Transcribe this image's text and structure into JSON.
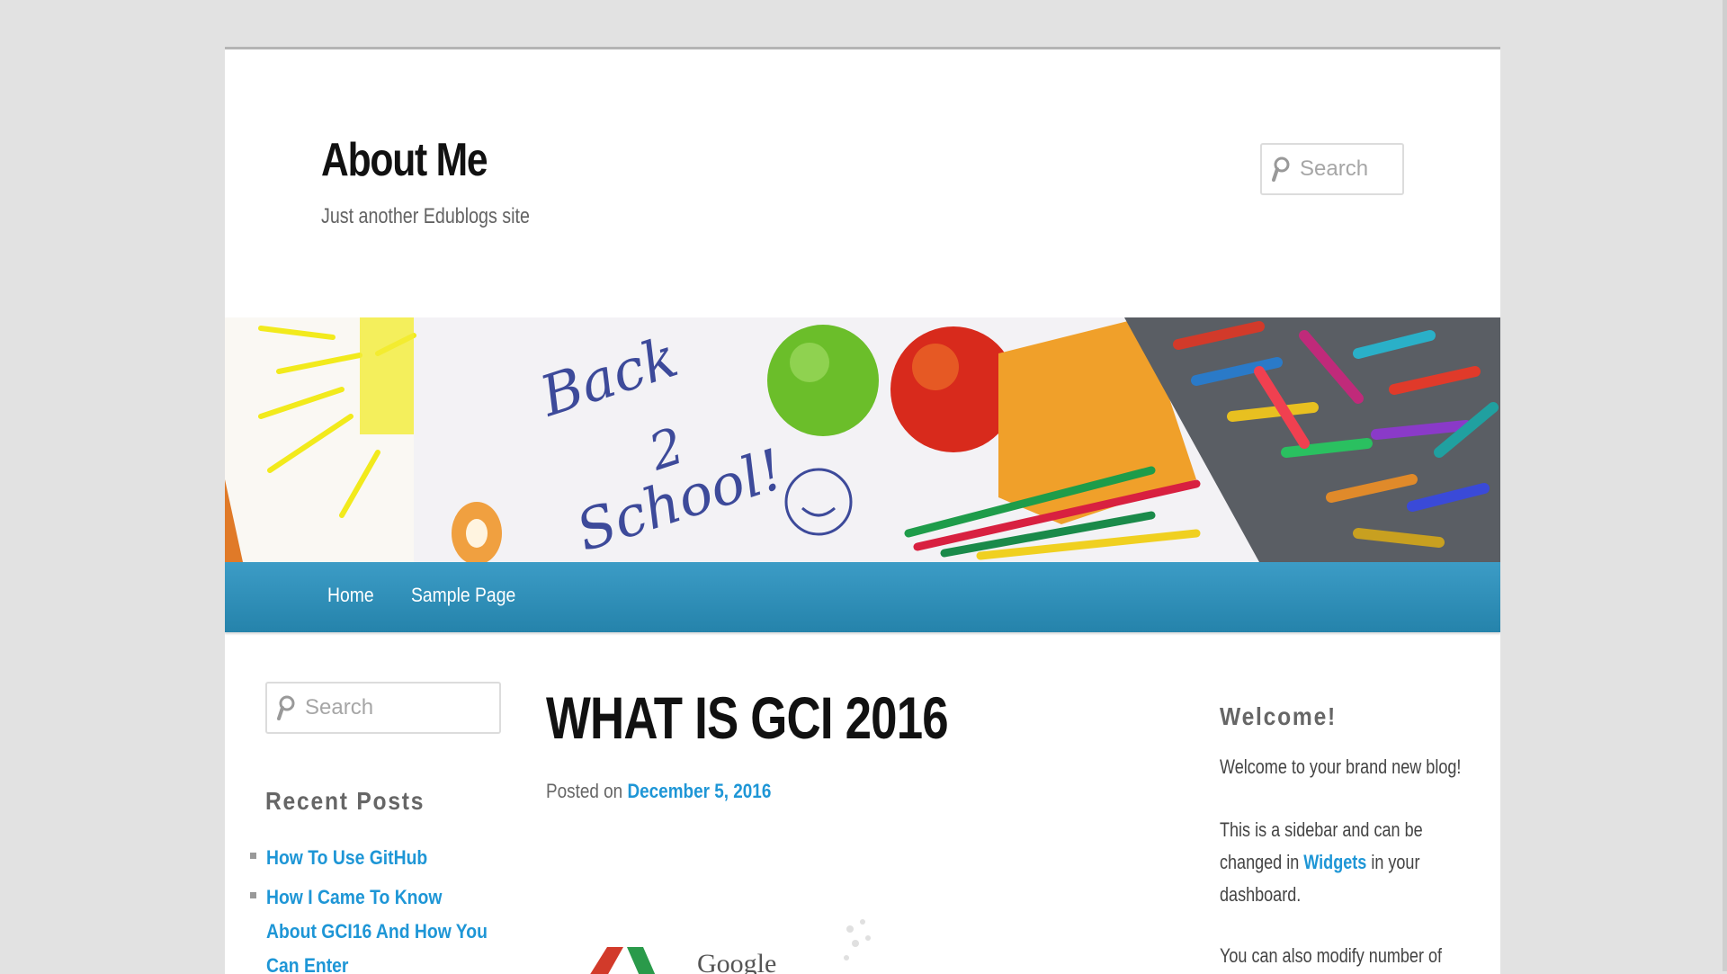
{
  "site": {
    "title": "About Me",
    "description": "Just another Edublogs site"
  },
  "header_search": {
    "placeholder": "Search"
  },
  "nav": {
    "items": [
      {
        "label": "Home"
      },
      {
        "label": "Sample Page"
      }
    ]
  },
  "left_sidebar": {
    "search_placeholder": "Search",
    "recent_posts_title": "Recent Posts",
    "recent_posts": [
      {
        "title": "How To Use GitHub"
      },
      {
        "title": "How I Came To Know About GCI16 And How You Can Enter"
      }
    ]
  },
  "post": {
    "title": "WHAT IS GCI 2016",
    "posted_on_label": "Posted on",
    "date": "December 5, 2016",
    "image_text": "Google"
  },
  "right_sidebar": {
    "welcome_title": "Welcome!",
    "p1": "Welcome to your brand new blog!",
    "p2_before": "This is a sidebar and can be changed in",
    "p2_link": "Widgets",
    "p2_after": "in your dashboard.",
    "p3": "You can also modify number of"
  },
  "banner": {
    "handwriting_1": "Back",
    "handwriting_2": "2",
    "handwriting_3": "School!"
  },
  "colors": {
    "nav": "#2e92bb",
    "link": "#1e96d6",
    "page_bg": "#e2e2e2"
  }
}
